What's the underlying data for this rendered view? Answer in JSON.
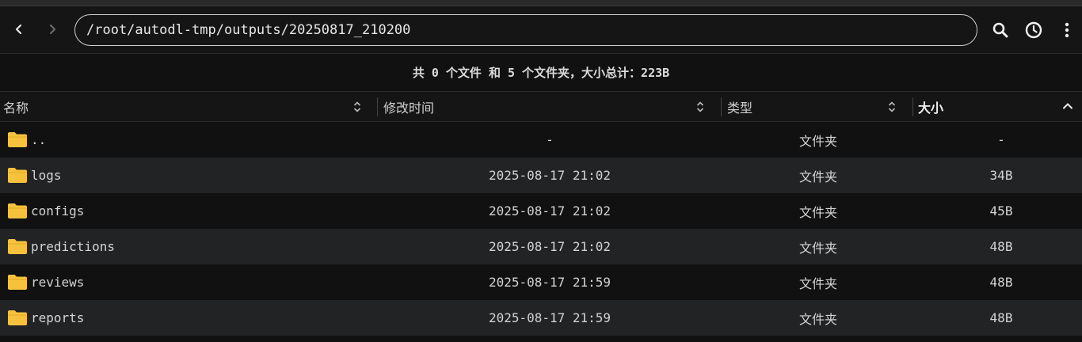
{
  "toolbar": {
    "back_icon": "chevron-left-icon",
    "forward_icon": "chevron-right-icon",
    "path": "/root/autodl-tmp/outputs/20250817_210200",
    "search_icon": "search-icon",
    "history_icon": "clock-icon",
    "menu_icon": "more-vertical-icon"
  },
  "summary": "共 0 个文件 和 5 个文件夹，大小总计：223B",
  "columns": {
    "name": "名称",
    "modified": "修改时间",
    "type": "类型",
    "size": "大小"
  },
  "rows": [
    {
      "name": "..",
      "modified": "-",
      "type": "文件夹",
      "size": "-"
    },
    {
      "name": "logs",
      "modified": "2025-08-17 21:02",
      "type": "文件夹",
      "size": "34B"
    },
    {
      "name": "configs",
      "modified": "2025-08-17 21:02",
      "type": "文件夹",
      "size": "45B"
    },
    {
      "name": "predictions",
      "modified": "2025-08-17 21:02",
      "type": "文件夹",
      "size": "48B"
    },
    {
      "name": "reviews",
      "modified": "2025-08-17 21:59",
      "type": "文件夹",
      "size": "48B"
    },
    {
      "name": "reports",
      "modified": "2025-08-17 21:59",
      "type": "文件夹",
      "size": "48B"
    }
  ],
  "colors": {
    "folder": "#f6c23e",
    "background": "#111111",
    "alt_row": "#222325"
  }
}
